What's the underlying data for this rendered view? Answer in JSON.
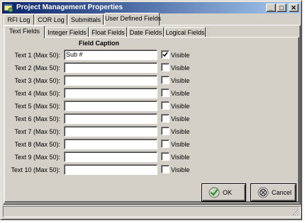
{
  "window": {
    "title": "Project Management Properties",
    "minimize_glyph": "_",
    "maximize_glyph": "□",
    "close_glyph": "✕"
  },
  "tabs": [
    {
      "label": "RFI Log"
    },
    {
      "label": "COR Log"
    },
    {
      "label": "Submittals"
    },
    {
      "label": "User Defined Fields",
      "active": true
    }
  ],
  "subtabs": [
    {
      "label": "Text Fields",
      "active": true
    },
    {
      "label": "Integer Fields"
    },
    {
      "label": "Float Fields"
    },
    {
      "label": "Date Fields"
    },
    {
      "label": "Logical Fields"
    }
  ],
  "form": {
    "column_header": "Field Caption",
    "rows": [
      {
        "label": "Text 1 (Max 50):",
        "value": "Sub #",
        "visible_label": "Visible",
        "visible_checked": true
      },
      {
        "label": "Text 2 (Max 50):",
        "value": "",
        "visible_label": "Visible",
        "visible_checked": false
      },
      {
        "label": "Text 3 (Max 50):",
        "value": "",
        "visible_label": "Visible",
        "visible_checked": false
      },
      {
        "label": "Text 4 (Max 50):",
        "value": "",
        "visible_label": "Visible",
        "visible_checked": false
      },
      {
        "label": "Text 5 (Max 50):",
        "value": "",
        "visible_label": "Visible",
        "visible_checked": false
      },
      {
        "label": "Text 6 (Max 50):",
        "value": "",
        "visible_label": "Visible",
        "visible_checked": false
      },
      {
        "label": "Text 7 (Max 50):",
        "value": "",
        "visible_label": "Visible",
        "visible_checked": false
      },
      {
        "label": "Text 8 (Max 50):",
        "value": "",
        "visible_label": "Visible",
        "visible_checked": false
      },
      {
        "label": "Text 9 (Max 50):",
        "value": "",
        "visible_label": "Visible",
        "visible_checked": false
      },
      {
        "label": "Text 10 (Max 50):",
        "value": "",
        "visible_label": "Visible",
        "visible_checked": false
      }
    ]
  },
  "buttons": {
    "ok_label": "OK",
    "cancel_label": "Cancel"
  },
  "icons": {
    "app": "app-window-icon",
    "ok": "checkmark-icon",
    "cancel": "cancel-x-icon",
    "check": "checkmark-icon",
    "grip": "resize-grip-icon"
  },
  "colors": {
    "titlebar_start": "#0a246a",
    "titlebar_end": "#a6caf0",
    "face": "#d4d0c8",
    "ok_icon": "#2e8b2e",
    "cancel_icon": "#404040"
  }
}
